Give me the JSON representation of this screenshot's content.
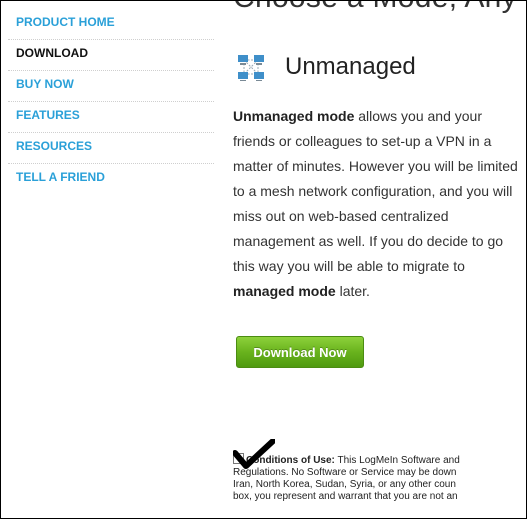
{
  "sidebar": {
    "items": [
      {
        "label": "PRODUCT HOME"
      },
      {
        "label": "DOWNLOAD"
      },
      {
        "label": "BUY NOW"
      },
      {
        "label": "FEATURES"
      },
      {
        "label": "RESOURCES"
      },
      {
        "label": "TELL A FRIEND"
      }
    ]
  },
  "main": {
    "top_heading": "Choose a Mode, Any",
    "mode_title": "Unmanaged",
    "mode_icon": "mesh-network-icon",
    "desc": {
      "bold_lead": "Unmanaged mode",
      "body": " allows you and your friends or colleagues to set-up a VPN in a matter of minutes. However you will be limited to a mesh network configuration, and you will miss out on web-based centralized management as well. If you do decide to go this way you will be able to migrate to ",
      "bold_tail": "managed mode",
      "end": " later."
    },
    "download_label": "Download Now",
    "terms": {
      "bold_label": "Conditions of Use:",
      "line1_rest": " This LogMeIn Software and",
      "line2": "Regulations. No Software or Service may be down",
      "line3": "Iran, North Korea, Sudan, Syria, or any other coun",
      "line4": "box, you represent and warrant that you are not an"
    }
  },
  "colors": {
    "nav_link": "#2aa0d8",
    "nav_active": "#111111",
    "button_green": "#69b31d"
  }
}
